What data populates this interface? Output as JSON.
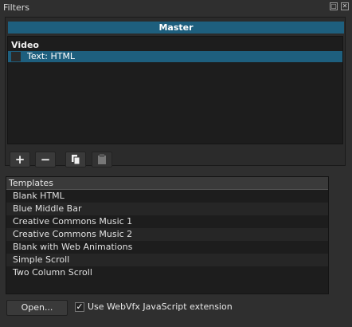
{
  "window": {
    "title": "Filters"
  },
  "filters": {
    "master_label": "Master",
    "category": "Video",
    "items": [
      {
        "label": "Text: HTML",
        "selected": true
      }
    ]
  },
  "toolbar": {
    "add_icon": "+",
    "remove_icon": "−",
    "copy_icon": "copy-icon",
    "paste_icon": "paste-icon"
  },
  "templates": {
    "header": "Templates",
    "items": [
      "Blank HTML",
      "Blue Middle Bar",
      "Creative Commons Music 1",
      "Creative Commons Music 2",
      "Blank with Web Animations",
      "Simple Scroll",
      "Two Column Scroll"
    ]
  },
  "bottom": {
    "open_label": "Open...",
    "webvfx_label": "Use WebVfx JavaScript extension",
    "webvfx_checked": true
  },
  "colors": {
    "accent": "#1e5f7e",
    "background": "#2f2f2f"
  }
}
